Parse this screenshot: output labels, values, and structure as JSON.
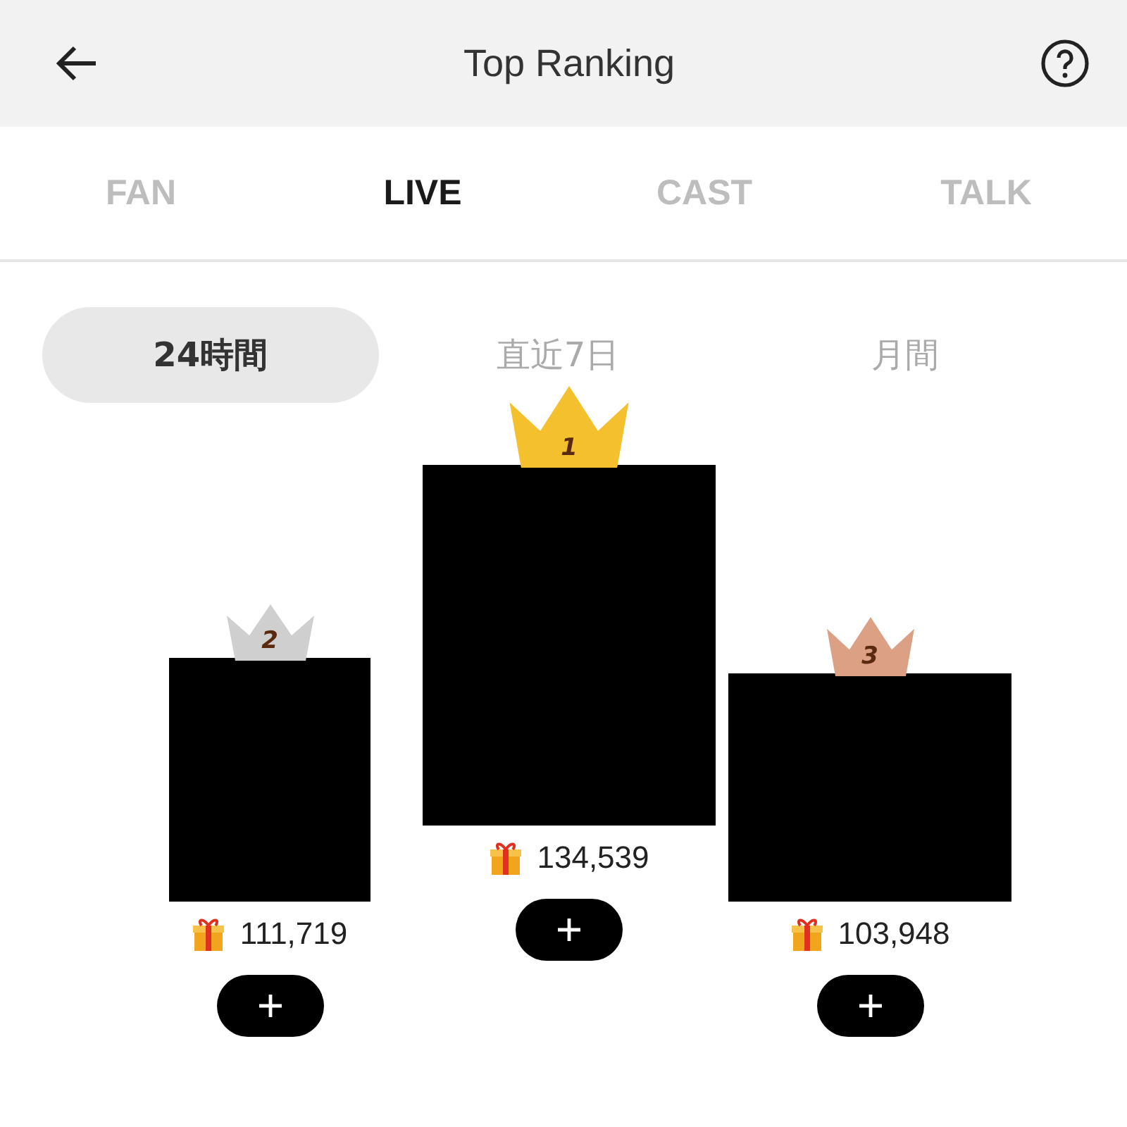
{
  "header": {
    "title": "Top Ranking"
  },
  "tabs": [
    {
      "label": "FAN",
      "selected": false
    },
    {
      "label": "LIVE",
      "selected": true
    },
    {
      "label": "CAST",
      "selected": false
    },
    {
      "label": "TALK",
      "selected": false
    }
  ],
  "periods": [
    {
      "label": "24時間",
      "selected": true
    },
    {
      "label": "直近7日",
      "selected": false
    },
    {
      "label": "月間",
      "selected": false
    }
  ],
  "podium": [
    {
      "rank": "2",
      "color": "#cfcfcf",
      "score": "111,719"
    },
    {
      "rank": "1",
      "color": "#f5c02e",
      "score": "134,539"
    },
    {
      "rank": "3",
      "color": "#dca084",
      "score": "103,948"
    }
  ]
}
